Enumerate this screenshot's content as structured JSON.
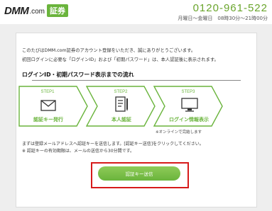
{
  "header": {
    "logo_dmm": "DMM",
    "logo_com": ".com",
    "logo_badge": "証券",
    "phone_number": "0120-961-522",
    "phone_hours": "月曜日～金曜日　08時30分～21時00分"
  },
  "intro": {
    "line1": "このたびはDMM.com証券のアカウント登録をいただき、誠にありがとうございます。",
    "line2": "初回ログインに必要な「ログインID」および「初期パスワード」は、本人認証後に表示されます。"
  },
  "section_title": "ログインID・初期パスワード表示までの流れ",
  "steps": [
    {
      "step": "STEP1",
      "name": "認証キー発行",
      "icon": "envelope-icon"
    },
    {
      "step": "STEP2",
      "name": "本人認証",
      "icon": "document-pen-icon"
    },
    {
      "step": "STEP3",
      "name": "ログイン情報表示",
      "icon": "monitor-icon"
    }
  ],
  "online_note": "※オンラインで完結します",
  "description": {
    "line1": "まずは登録メールアドレスへ認証キーを送信します。[認証キー送信]をクリックしてください。",
    "line2": "※ 認証キーの有効期限は、メールの送信から30分間です。"
  },
  "send_button": "認証キー送信",
  "colors": {
    "accent": "#6ab43c",
    "highlight": "#d71a1a"
  }
}
